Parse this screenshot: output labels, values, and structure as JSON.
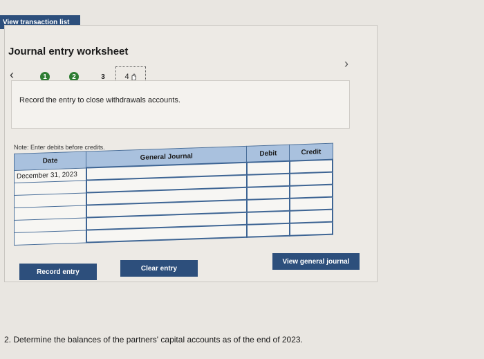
{
  "top": {
    "view_transaction_list": "View transaction list"
  },
  "worksheet": {
    "title": "Journal entry worksheet",
    "steps": [
      "1",
      "2",
      "3",
      "4"
    ],
    "instruction": "Record the entry to close withdrawals accounts.",
    "note": "Note: Enter debits before credits."
  },
  "table": {
    "headers": [
      "Date",
      "General Journal",
      "Debit",
      "Credit"
    ],
    "rows": [
      [
        "December 31, 2023",
        "",
        "",
        ""
      ],
      [
        "",
        "",
        "",
        ""
      ],
      [
        "",
        "",
        "",
        ""
      ],
      [
        "",
        "",
        "",
        ""
      ],
      [
        "",
        "",
        "",
        ""
      ],
      [
        "",
        "",
        "",
        ""
      ]
    ]
  },
  "buttons": {
    "record_entry": "Record entry",
    "clear_entry": "Clear entry",
    "view_general_journal": "View general journal"
  },
  "question": "2. Determine the balances of the partners' capital accounts as of the end of 2023.",
  "colors": {
    "button_blue": "#2d4f7c",
    "header_blue": "#a9c1de",
    "step_green": "#2e7d32"
  },
  "icons": {
    "prev": "chevron-left-icon",
    "next": "chevron-right-icon",
    "cursor": "hand-pointer-icon"
  }
}
